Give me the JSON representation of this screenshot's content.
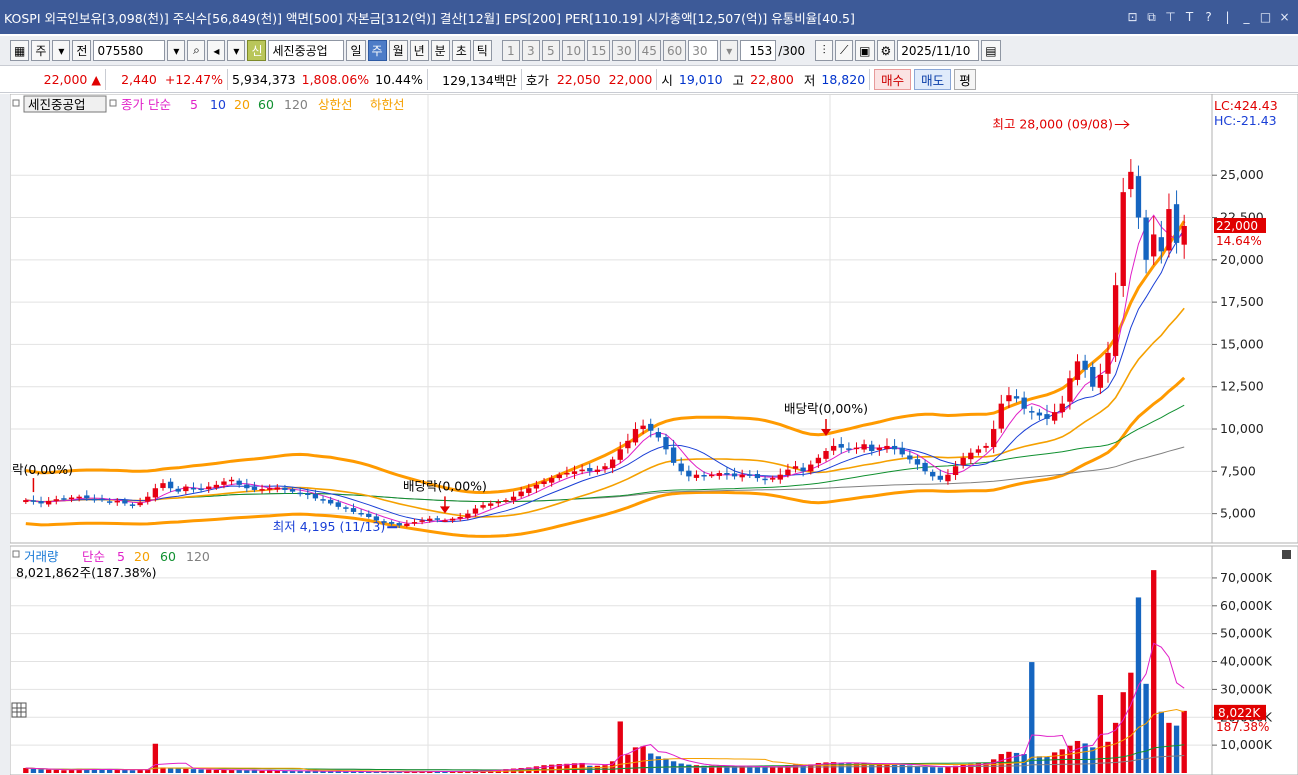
{
  "titlebar": {
    "text": "KOSPI 외국인보유[3,098(천)] 주식수[56,849(천)] 액면[500] 자본금[312(억)] 결산[12월] EPS[200] PER[110.19] 시가총액[12,507(억)] 유통비율[40.5]",
    "icons": [
      "restore-icon",
      "copy-icon",
      "pin-icon",
      "font-icon",
      "help-icon",
      "minimize-icon",
      "maximize-icon",
      "close-icon"
    ]
  },
  "toolbar": {
    "market": "주",
    "all_label": "전",
    "code": "075580",
    "new_label": "신",
    "stock_name": "세진중공업",
    "periods": [
      "일",
      "주",
      "월",
      "년",
      "분",
      "초",
      "틱"
    ],
    "selected_period": "주",
    "intervals": [
      "1",
      "3",
      "5",
      "10",
      "15",
      "30",
      "45",
      "60"
    ],
    "interval_value": "30",
    "count": "153",
    "count_total": "/300",
    "date": "2025/11/10"
  },
  "quote": {
    "price": "22,000",
    "arrow": "▲",
    "change": "2,440",
    "change_pct": "+12.47%",
    "volume": "5,934,373",
    "volume_pct": "1,808.06%",
    "turnover": "10.44%",
    "amount": "129,134백만",
    "hoga_label": "호가",
    "hoga_ask": "22,050",
    "hoga_bid": "22,000",
    "open_label": "시",
    "open": "19,010",
    "high_label": "고",
    "high": "22,800",
    "low_label": "저",
    "low": "18,820",
    "buy_label": "매수",
    "sell_label": "매도",
    "avg_label": "평"
  },
  "price_panel": {
    "legend": {
      "stock": "세진중공업",
      "ma_label": "종가 단순",
      "ma_periods": [
        "5",
        "10",
        "20",
        "60",
        "120"
      ],
      "upper_label": "상한선",
      "lower_label": "하한선"
    },
    "lc": "LC:424.43",
    "hc": "HC:-21.43",
    "current_price": "22,000",
    "current_pct": "14.64%",
    "annotations": {
      "high": "최고 28,000 (09/08)",
      "low": "최저 4,195 (11/13)",
      "div1": "배당락(0,00%)",
      "div2": "배당락(0,00%)",
      "div0": "락(0,00%)"
    }
  },
  "volume_panel": {
    "legend": {
      "label": "거래량",
      "ma_label": "단순",
      "ma_periods": [
        "5",
        "20",
        "60",
        "120"
      ]
    },
    "last_value": "8,021,862주(187.38%)",
    "current_label": "8,022K",
    "current_pct": "187.38%"
  },
  "colors": {
    "up": "#e60012",
    "down": "#1565c0",
    "ma5": "#e020c8",
    "ma10": "#1a3fd6",
    "ma20": "#f5a000",
    "ma60": "#109030",
    "ma120": "#808080",
    "envelope": "#ff9a00"
  },
  "chart_data": [
    {
      "type": "candlestick",
      "name": "price",
      "ylim": [
        3500,
        28500
      ],
      "y_ticks": [
        5000,
        7500,
        10000,
        12500,
        15000,
        17500,
        20000,
        22500,
        25000
      ],
      "y_tick_labels": [
        "5,000",
        "7,500",
        "10,000",
        "12,500",
        "15,000",
        "17,500",
        "20,000",
        "22,500",
        "25,000"
      ],
      "close": [
        5800,
        5700,
        5600,
        5750,
        5850,
        5900,
        5950,
        6000,
        5900,
        5850,
        5800,
        5700,
        5750,
        5600,
        5500,
        5650,
        6000,
        6500,
        6800,
        6500,
        6300,
        6600,
        6500,
        6400,
        6600,
        6700,
        6900,
        7000,
        6700,
        6500,
        6400,
        6450,
        6500,
        6550,
        6400,
        6300,
        6200,
        6100,
        5900,
        5800,
        5600,
        5400,
        5300,
        5100,
        5000,
        4800,
        4600,
        4500,
        4400,
        4300,
        4400,
        4500,
        4600,
        4700,
        4650,
        4600,
        4700,
        4800,
        5000,
        5300,
        5500,
        5600,
        5700,
        5800,
        6000,
        6300,
        6500,
        6700,
        6900,
        7100,
        7300,
        7400,
        7500,
        7600,
        7500,
        7600,
        7800,
        8200,
        8800,
        9300,
        10000,
        10200,
        9900,
        9500,
        8800,
        8000,
        7500,
        7200,
        7300,
        7200,
        7300,
        7400,
        7300,
        7200,
        7300,
        7250,
        7100,
        7000,
        7100,
        7300,
        7600,
        7800,
        7500,
        7900,
        8300,
        8700,
        9000,
        8900,
        8800,
        8900,
        9100,
        8700,
        8900,
        9000,
        8800,
        8500,
        8200,
        7900,
        7500,
        7200,
        7000,
        7300,
        7800,
        8300,
        8600,
        8800,
        9000,
        10000,
        11500,
        12000,
        11800,
        11200,
        11000,
        10800,
        10600,
        11000,
        11500,
        13000,
        14000,
        13500,
        12500,
        13200,
        14500,
        18500,
        24000,
        25200,
        22500,
        20000,
        21500,
        20500,
        23000,
        21000,
        22000
      ],
      "annotations": {
        "max": {
          "value": 28000,
          "date": "09/08"
        },
        "min": {
          "value": 4195,
          "date": "11/13"
        }
      }
    },
    {
      "type": "bar",
      "name": "volume",
      "ylim": [
        0,
        75000
      ],
      "y_ticks": [
        10000,
        20000,
        30000,
        40000,
        50000,
        60000,
        70000
      ],
      "y_tick_labels": [
        "10,000K",
        "20,000K",
        "30,000K",
        "40,000K",
        "50,000K",
        "60,000K",
        "70,000K"
      ],
      "values": [
        1800,
        1500,
        1300,
        1200,
        1100,
        1000,
        1200,
        1500,
        1300,
        1200,
        1100,
        1300,
        1200,
        1100,
        1000,
        1100,
        1400,
        2600,
        2000,
        1800,
        1700,
        1500,
        1400,
        1300,
        1200,
        1100,
        1100,
        1200,
        1200,
        1000,
        900,
        800,
        900,
        900,
        800,
        700,
        700,
        700,
        600,
        600,
        600,
        600,
        500,
        500,
        500,
        500,
        400,
        400,
        400,
        400,
        500,
        500,
        500,
        600,
        600,
        500,
        500,
        600,
        700,
        800,
        900,
        1000,
        1200,
        1400,
        1600,
        1800,
        2000,
        2400,
        2800,
        3000,
        3200,
        3300,
        3500,
        3600,
        2600,
        2600,
        2800,
        4200,
        5600,
        6600,
        9200,
        9600,
        7000,
        6000,
        5200,
        4200,
        3400,
        3000,
        2800,
        2600,
        2600,
        2600,
        2600,
        2400,
        2400,
        2300,
        2200,
        2100,
        2200,
        2400,
        2800,
        3000,
        2800,
        3100,
        3600,
        3800,
        3900,
        3600,
        3500,
        3400,
        3600,
        3200,
        3300,
        3400,
        3100,
        2900,
        2700,
        2500,
        2300,
        2100,
        2000,
        2200,
        2600,
        3000,
        3300,
        3500,
        3700,
        4900,
        6800,
        7600,
        7200,
        6800,
        6400,
        6000,
        5800,
        7400,
        8500,
        9800,
        11500,
        10600,
        9200,
        10000,
        11200,
        18000,
        31000,
        36000,
        38000,
        32000,
        28000,
        22000,
        18000,
        17000,
        16000
      ],
      "spikes": {
        "17": 10500,
        "78": 18500,
        "132": 39800,
        "141": 28000,
        "144": 29000,
        "146": 63000,
        "148": 72800,
        "152": 22300,
        "154": 8022
      }
    }
  ]
}
